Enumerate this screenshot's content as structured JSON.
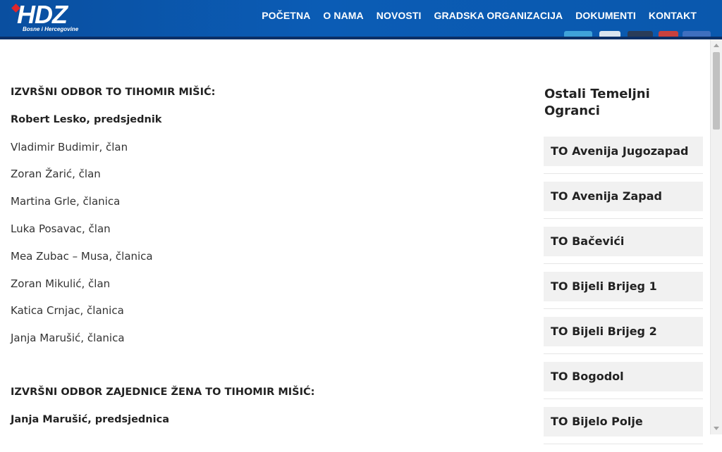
{
  "header": {
    "logo_text": "HDZ",
    "logo_subtitle": "Bosne i Hercegovine",
    "nav": [
      {
        "label": "POČETNA"
      },
      {
        "label": "O NAMA"
      },
      {
        "label": "NOVOSTI"
      },
      {
        "label": "GRADSKA ORGANIZACIJA"
      },
      {
        "label": "DOKUMENTI"
      },
      {
        "label": "KONTAKT"
      }
    ]
  },
  "main": {
    "section1_title": "IZVRŠNI ODBOR TO TIHOMIR MIŠIĆ:",
    "section1_lead": "Robert  Lesko, predsjednik",
    "section1_members": [
      "Vladimir Budimir, član",
      "Zoran Žarić, član",
      "Martina Grle, članica",
      "Luka Posavac, član",
      "Mea Zubac – Musa, članica",
      "Zoran Mikulić, član",
      "Katica Crnjac, članica",
      "Janja Marušić, članica"
    ],
    "section2_title": "IZVRŠNI ODBOR ZAJEDNICE ŽENA TO TIHOMIR MIŠIĆ:",
    "section2_lead": "Janja Marušić, predsjednica"
  },
  "sidebar": {
    "title": "Ostali Temeljni Ogranci",
    "items": [
      {
        "label": "TO Avenija Jugozapad"
      },
      {
        "label": "TO Avenija Zapad"
      },
      {
        "label": "TO Bačevići"
      },
      {
        "label": "TO Bijeli Brijeg 1"
      },
      {
        "label": "TO Bijeli Brijeg 2"
      },
      {
        "label": "TO Bogodol"
      },
      {
        "label": "TO Bijelo Polje"
      }
    ]
  },
  "colors": {
    "header_blue": "#0b5cb5",
    "header_dark": "#0b2f66",
    "logo_red": "#e0262b",
    "sidebar_item_bg": "#f1f1f1"
  }
}
